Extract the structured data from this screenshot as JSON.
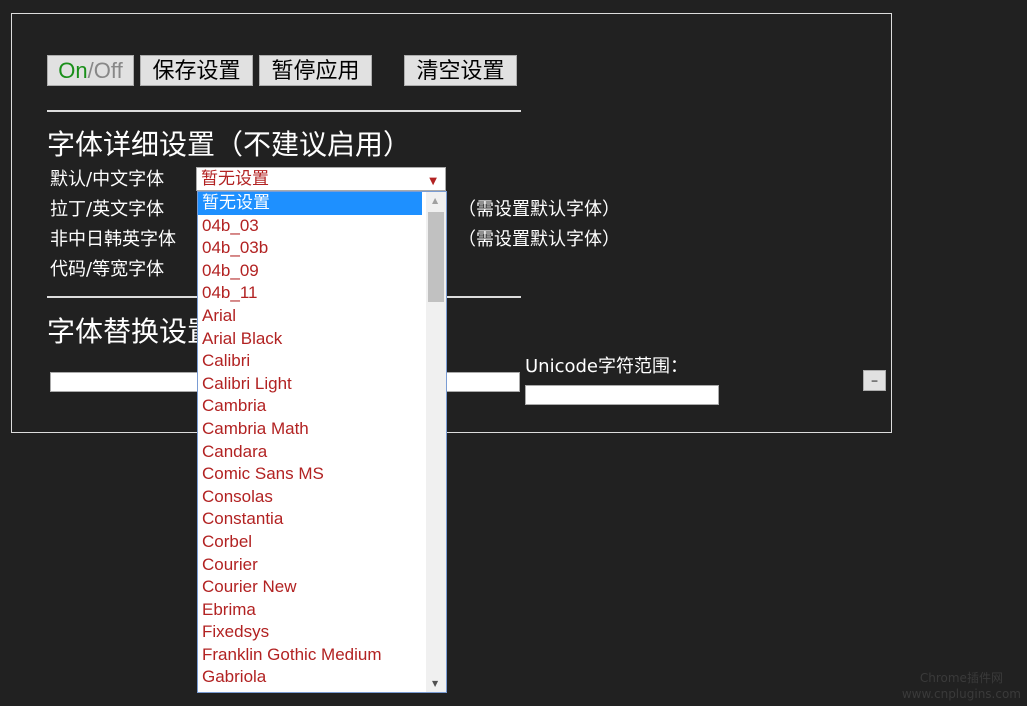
{
  "toolbar": {
    "on": "On",
    "slash": "/",
    "off": "Off",
    "save": "保存设置",
    "pause": "暂停应用",
    "clear": "清空设置"
  },
  "detail": {
    "title": "字体详细设置（不建议启用）",
    "rows": [
      {
        "label": "默认/中文字体"
      },
      {
        "label": "拉丁/英文字体",
        "note": "（需设置默认字体）"
      },
      {
        "label": "非中日韩英字体",
        "note": "（需设置默认字体）"
      },
      {
        "label": "代码/等宽字体"
      }
    ],
    "select_value": "暂无设置"
  },
  "dropdown": {
    "options": [
      "暂无设置",
      "04b_03",
      "04b_03b",
      "04b_09",
      "04b_11",
      "Arial",
      "Arial Black",
      "Calibri",
      "Calibri Light",
      "Cambria",
      "Cambria Math",
      "Candara",
      "Comic Sans MS",
      "Consolas",
      "Constantia",
      "Corbel",
      "Courier",
      "Courier New",
      "Ebrima",
      "Fixedsys",
      "Franklin Gothic Medium",
      "Gabriola"
    ],
    "selected": "暂无设置"
  },
  "replace": {
    "title": "字体替换设置",
    "unicode_label": "Unicode字符范围：",
    "remove_label": "−"
  },
  "watermark": {
    "line1": "Chrome插件网",
    "line2": "www.cnplugins.com"
  },
  "colors": {
    "on": "#1a8f1a",
    "off": "#888888",
    "option_text": "#b22222",
    "highlight": "#1e90ff"
  }
}
